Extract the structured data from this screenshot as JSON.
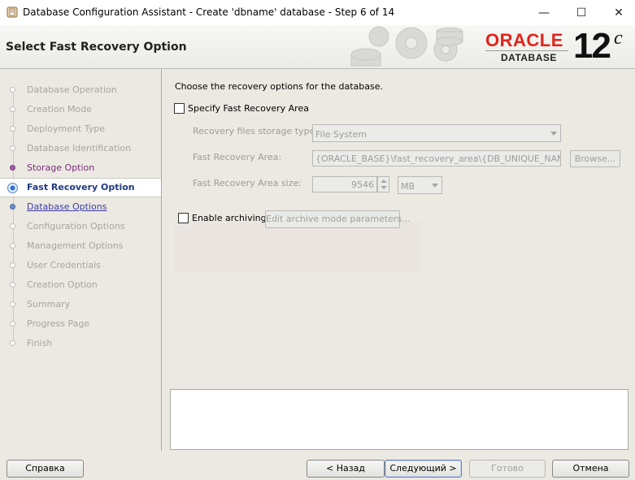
{
  "window": {
    "title": "Database Configuration Assistant - Create 'dbname' database - Step 6 of 14",
    "min_glyph": "—",
    "max_glyph": "☐",
    "close_glyph": "✕"
  },
  "header": {
    "page_title": "Select Fast Recovery Option",
    "brand": "ORACLE",
    "brand_sub": "DATABASE",
    "version": "12",
    "version_suffix": "c",
    "brand_color": "#e2231a"
  },
  "nav": {
    "items": [
      {
        "label": "Database Operation",
        "state": "disabled"
      },
      {
        "label": "Creation Mode",
        "state": "disabled"
      },
      {
        "label": "Deployment Type",
        "state": "disabled"
      },
      {
        "label": "Database Identification",
        "state": "disabled"
      },
      {
        "label": "Storage Option",
        "state": "visited"
      },
      {
        "label": "Fast Recovery Option",
        "state": "current"
      },
      {
        "label": "Database Options",
        "state": "link"
      },
      {
        "label": "Configuration Options",
        "state": "disabled"
      },
      {
        "label": "Management Options",
        "state": "disabled"
      },
      {
        "label": "User Credentials",
        "state": "disabled"
      },
      {
        "label": "Creation Option",
        "state": "disabled"
      },
      {
        "label": "Summary",
        "state": "disabled"
      },
      {
        "label": "Progress Page",
        "state": "disabled"
      },
      {
        "label": "Finish",
        "state": "disabled"
      }
    ]
  },
  "content": {
    "intro": "Choose the recovery options for the database.",
    "specify_fra_label": "Specify Fast Recovery Area",
    "specify_fra_checked": false,
    "storage_type_label": "Recovery files storage type:",
    "storage_type_value": "File System",
    "fra_label": "Fast Recovery Area:",
    "fra_value": "{ORACLE_BASE}\\fast_recovery_area\\{DB_UNIQUE_NAME}",
    "browse_label": "Browse...",
    "fra_size_label": "Fast Recovery Area size:",
    "fra_size_value": "9546",
    "fra_size_unit": "MB",
    "enable_archiving_label": "Enable archiving",
    "enable_archiving_checked": false,
    "edit_archive_label": "Edit archive mode parameters..."
  },
  "footer": {
    "help_label": "Справка",
    "back_label": "< Назад",
    "next_label": "Следующий >",
    "finish_label": "Готово",
    "cancel_label": "Отмена"
  }
}
